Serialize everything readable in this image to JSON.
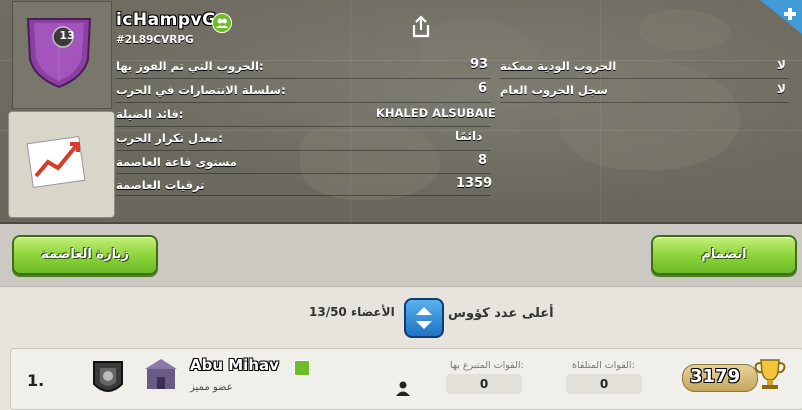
{
  "clan": {
    "name": "icHampvG",
    "tag": "#2L89CVRPG",
    "level": "13"
  },
  "stats": {
    "wars_won_label": "الحروب التي تم الفوز بها:",
    "wars_won_value": "93",
    "win_streak_label": "سلسلة الانتصارات في الحرب:",
    "win_streak_value": "6",
    "war_league_label": "قائد الضيلة:",
    "war_league_value": "KHALED ALSUBAIE",
    "war_frequency_label": "معدل تكرار الحرب:",
    "war_frequency_value": "دائمًا",
    "capital_hall_label": "مستوى قاعة العاصمة",
    "capital_hall_value": "8",
    "capital_trophies_label": "ترقيات العاصمة",
    "capital_trophies_value": "1359",
    "friendly_wars_label": "الحروب الودية ممكنة",
    "friendly_wars_value": "لا",
    "war_log_label": "سجل الحروب العام",
    "war_log_value": "لا"
  },
  "buttons": {
    "visit_capital": "زيارة العاصمة",
    "join": "انضمام"
  },
  "sort": {
    "label": "أعلى عدد كؤوس",
    "members_label": "الأعضاء",
    "members_count": "13/50"
  },
  "member": {
    "rank": "1.",
    "name": "Abu Mihav",
    "role": "عضو مميز",
    "donated_label": "القوات المتبرع بها:",
    "donated_value": "0",
    "received_label": "القوات المتلقاة:",
    "received_value": "0",
    "trophies": "3179"
  },
  "colors": {
    "accent_green": "#8ed43c",
    "sort_blue": "#1f73c4",
    "panel": "#6f6d62"
  }
}
